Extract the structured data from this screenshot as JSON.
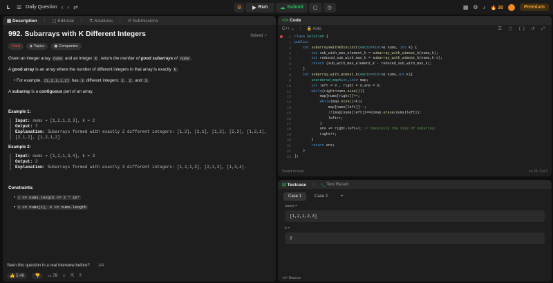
{
  "topbar": {
    "problem_list": "Daily Question",
    "run": "Run",
    "submit": "Submit",
    "streak": "30",
    "premium": "Premium"
  },
  "left_tabs": [
    "Description",
    "Editorial",
    "Solutions",
    "Submissions"
  ],
  "problem": {
    "title": "992. Subarrays with K Different Integers",
    "solved": "Solved",
    "difficulty": "Hard",
    "tag_topics": "Topics",
    "tag_companies": "Companies",
    "desc1_a": "Given an integer array ",
    "desc1_b": "nums",
    "desc1_c": " and an integer ",
    "desc1_d": "k",
    "desc1_e": ", return ",
    "desc1_f": "the number of ",
    "desc1_g": "good subarrays",
    "desc1_h": " of ",
    "desc1_i": "nums",
    "desc2_a": "A ",
    "desc2_b": "good array",
    "desc2_c": " is an array where the number of different integers in that array is exactly ",
    "desc2_d": "k",
    "bullet_a": "For example, ",
    "bullet_b": "[1,2,3,1,2]",
    "bullet_c": " has ",
    "bullet_d": "3",
    "bullet_e": " different integers: ",
    "bullet_f": "1",
    "bullet_g": "2",
    "bullet_h": "3",
    "desc3_a": "A ",
    "desc3_b": "subarray",
    "desc3_c": " is a ",
    "desc3_d": "contiguous",
    "desc3_e": " part of an array.",
    "ex1_title": "Example 1:",
    "ex1_input_label": "Input:",
    "ex1_input": " nums = [1,2,1,2,3], k = 2",
    "ex1_output_label": "Output:",
    "ex1_output": " 7",
    "ex1_expl_label": "Explanation:",
    "ex1_expl1": " Subarrays formed with exactly 2 different integers: [1,2], [2,1], [1,2], [2,3], [1,2,1],",
    "ex1_expl2": "[2,1,2], [1,2,1,2]",
    "ex2_title": "Example 2:",
    "ex2_input_label": "Input:",
    "ex2_input": " nums = [1,2,1,3,4], k = 3",
    "ex2_output_label": "Output:",
    "ex2_output": " 3",
    "ex2_expl_label": "Explanation:",
    "ex2_expl": " Subarrays formed with exactly 3 different integers: [1,2,1,3], [2,1,3], [1,3,4].",
    "constraints_title": "Constraints:",
    "c1": "1 <= nums.length <= 2 * 10⁴",
    "c2": "1 <= nums[i], k <= nums.length",
    "seen": "Seen this question in a real interview before?",
    "seen_count": "1/4",
    "likes": "5.4K",
    "comments": "79"
  },
  "code": {
    "tab": "Code",
    "language": "C++",
    "mode": "Auto",
    "saved": "Saved to local",
    "cursor": "Ln 23, Col 3",
    "lines": [
      "class Solution {",
      "public:",
      "    int subarraysWithKDistinct(vector<int>& nums, int k) {",
      "        int sub_with_max_element_k = subarray_with_atmost_k(nums,k);",
      "        int reduced_sub_with_max_k = subarray_with_atmost_k(nums,k-1);",
      "        return (sub_with_max_element_k - reduced_sub_with_max_k);",
      "    }",
      "    int subarray_with_atmost_k(vector<int>& nums,int k){",
      "        unordered_map<int,int> map;",
      "        int left = 0 , right = 0,ans = 0;",
      "        while(right<nums.size()){",
      "            map[nums[right]]++;",
      "            while(map.size()>k){",
      "                map[nums[left]]--;",
      "                if(map[nums[left]]==0)map.erase(nums[left]);",
      "                left++;",
      "            }",
      "            ans += right-left+1; // basically the size of subarray;",
      "            right++;",
      "        }",
      "        return ans;",
      "    }",
      "};"
    ]
  },
  "testcase": {
    "tab1": "Testcase",
    "tab2": "Test Result",
    "case1": "Case 1",
    "case2": "Case 2",
    "add": "+",
    "label1": "nums =",
    "value1": "[1,2,1,2,3]",
    "label2": "k =",
    "value2": "2",
    "source": "Source"
  },
  "colors": {
    "accent_green": "#2cbb5d",
    "hard": "#ef4743",
    "premium": "#f2a33a"
  }
}
